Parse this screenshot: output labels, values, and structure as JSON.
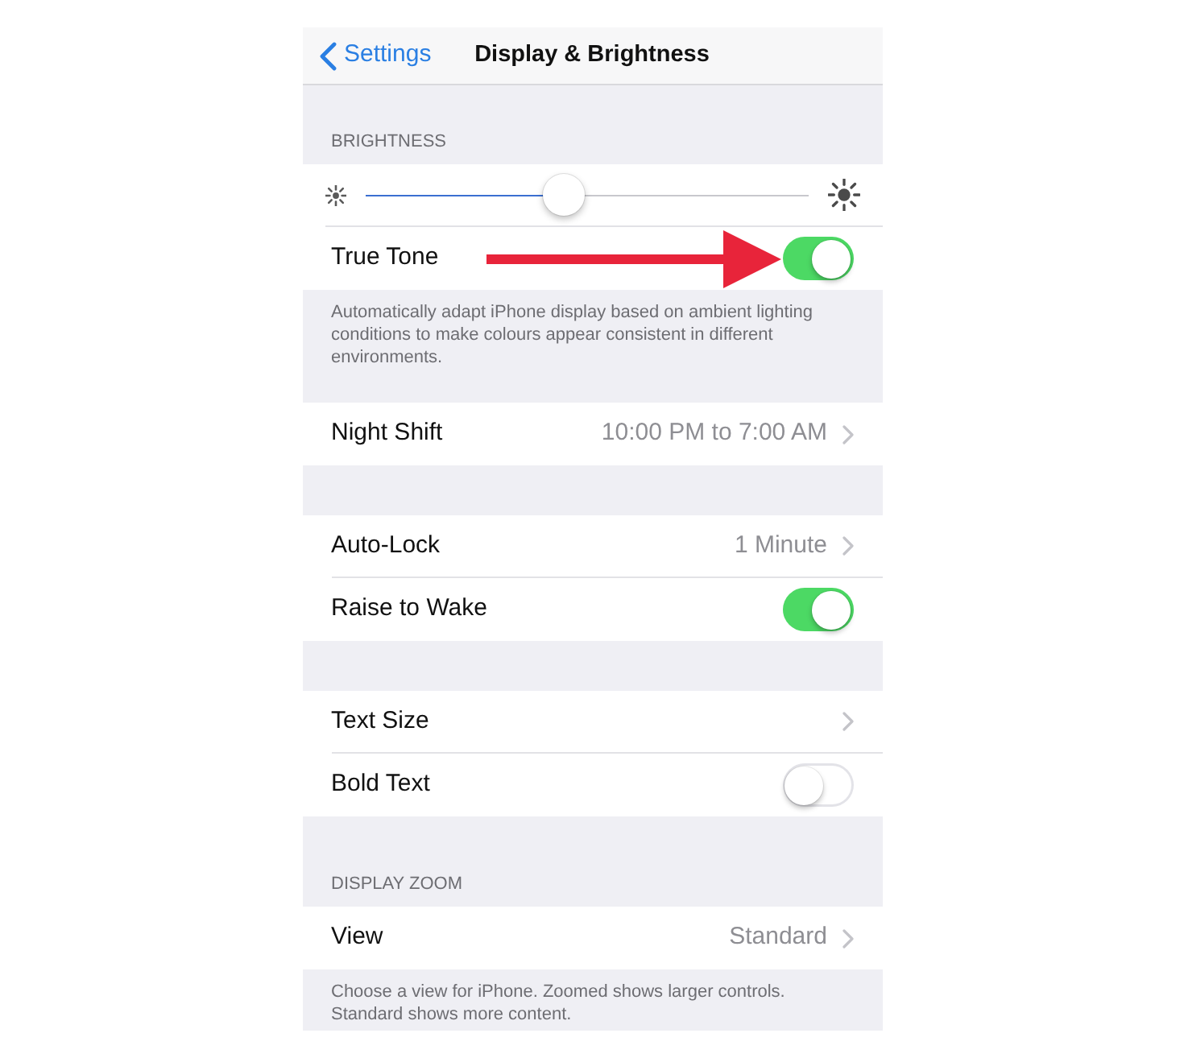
{
  "nav_bar": {
    "back_label": "Settings",
    "title": "Display & Brightness"
  },
  "sections": [
    {
      "header": "BRIGHTNESS",
      "rows": [
        {
          "kind": "slider",
          "level": 0.45
        },
        {
          "kind": "toggle",
          "label": "True Tone",
          "on": true,
          "annotated": true
        }
      ],
      "footer": "Automatically adapt iPhone display based on ambient lighting conditions to make colours appear consistent in different environments."
    },
    {
      "rows": [
        {
          "kind": "link",
          "label": "Night Shift",
          "value": "10:00 PM to 7:00 AM"
        }
      ]
    },
    {
      "rows": [
        {
          "kind": "link",
          "label": "Auto-Lock",
          "value": "1 Minute"
        },
        {
          "kind": "toggle",
          "label": "Raise to Wake",
          "on": true
        }
      ]
    },
    {
      "rows": [
        {
          "kind": "link",
          "label": "Text Size"
        },
        {
          "kind": "toggle",
          "label": "Bold Text",
          "on": false
        }
      ]
    },
    {
      "header": "DISPLAY ZOOM",
      "rows": [
        {
          "kind": "link",
          "label": "View",
          "value": "Standard"
        }
      ],
      "footer": "Choose a view for iPhone. Zoomed shows larger controls. Standard shows more content."
    }
  ]
}
